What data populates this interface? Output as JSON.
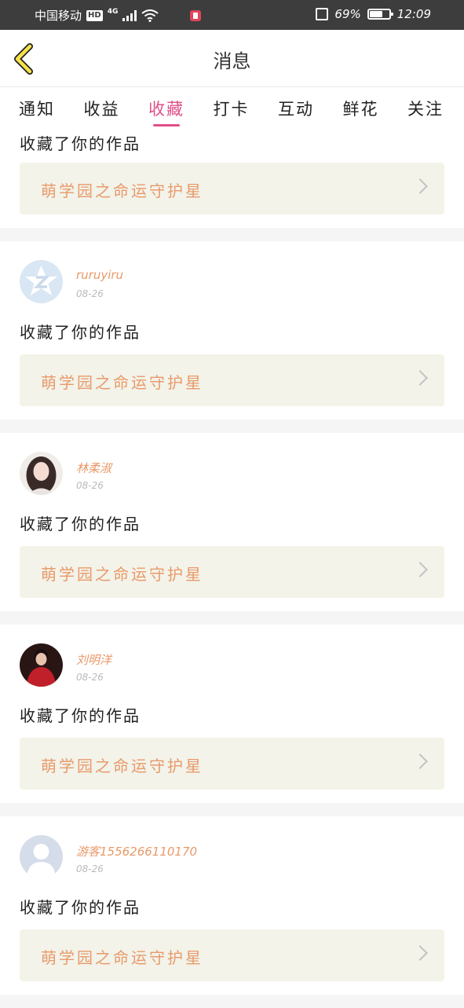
{
  "status_bar": {
    "carrier": "中国移动",
    "hd": "HD",
    "network": "4G",
    "battery": "69%",
    "battery_level": 0.69,
    "time": "12:09"
  },
  "header": {
    "title": "消息",
    "back_icon": "chevron-left-icon"
  },
  "tabs": [
    {
      "label": "通知",
      "active": false
    },
    {
      "label": "收益",
      "active": false
    },
    {
      "label": "收藏",
      "active": true
    },
    {
      "label": "打卡",
      "active": false
    },
    {
      "label": "互动",
      "active": false
    },
    {
      "label": "鲜花",
      "active": false
    },
    {
      "label": "关注",
      "active": false
    }
  ],
  "first_item": {
    "action": "收藏了你的作品",
    "work_title": "萌学园之命运守护星"
  },
  "items": [
    {
      "username": "ruruyiru",
      "date": "08-26",
      "action": "收藏了你的作品",
      "work_title": "萌学园之命运守护星",
      "avatar": "default-star-avatar"
    },
    {
      "username": "林柔淑",
      "date": "08-26",
      "action": "收藏了你的作品",
      "work_title": "萌学园之命运守护星",
      "avatar": "photo-avatar"
    },
    {
      "username": "刘明洋",
      "date": "08-26",
      "action": "收藏了你的作品",
      "work_title": "萌学园之命运守护星",
      "avatar": "photo-avatar"
    },
    {
      "username": "游客1556266110170",
      "date": "08-26",
      "action": "收藏了你的作品",
      "work_title": "萌学园之命运守护星",
      "avatar": "default-person-avatar"
    }
  ],
  "colors": {
    "accent": "#e0508a",
    "username": "#e89a6a",
    "work_box": "#f3f3ea",
    "back_icon": "#f4e24a"
  }
}
